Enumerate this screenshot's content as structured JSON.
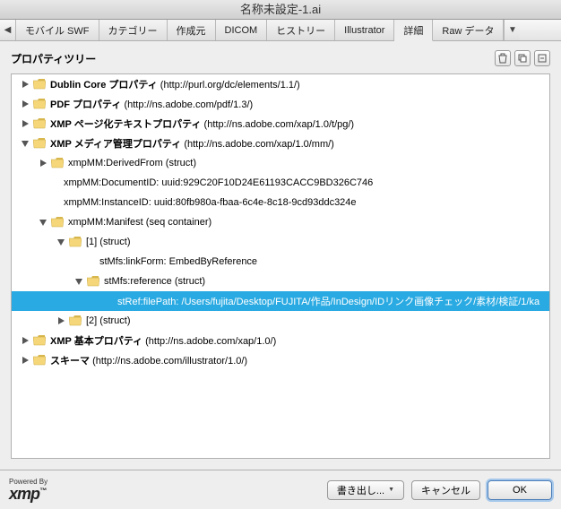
{
  "title": "名称未設定-1.ai",
  "tabs": [
    {
      "label": "モバイル SWF"
    },
    {
      "label": "カテゴリー"
    },
    {
      "label": "作成元"
    },
    {
      "label": "DICOM"
    },
    {
      "label": "ヒストリー"
    },
    {
      "label": "Illustrator"
    },
    {
      "label": "詳細"
    },
    {
      "label": "Raw データ"
    }
  ],
  "active_tab_index": 6,
  "section_title": "プロパティツリー",
  "tree": [
    {
      "indent": 0,
      "open": false,
      "folder": true,
      "bold": "Dublin Core プロパティ",
      "paren": "(http://purl.org/dc/elements/1.1/)"
    },
    {
      "indent": 0,
      "open": false,
      "folder": true,
      "bold": "PDF プロパティ",
      "paren": "(http://ns.adobe.com/pdf/1.3/)"
    },
    {
      "indent": 0,
      "open": false,
      "folder": true,
      "bold": "XMP ページ化テキストプロパティ",
      "paren": "(http://ns.adobe.com/xap/1.0/t/pg/)"
    },
    {
      "indent": 0,
      "open": true,
      "folder": true,
      "bold": "XMP メディア管理プロパティ",
      "paren": "(http://ns.adobe.com/xap/1.0/mm/)"
    },
    {
      "indent": 1,
      "open": false,
      "folder": true,
      "text": "xmpMM:DerivedFrom (struct)"
    },
    {
      "indent": 1,
      "nodis": true,
      "text": "xmpMM:DocumentID: uuid:929C20F10D24E61193CACC9BD326C746"
    },
    {
      "indent": 1,
      "nodis": true,
      "text": "xmpMM:InstanceID: uuid:80fb980a-fbaa-6c4e-8c18-9cd93ddc324e"
    },
    {
      "indent": 1,
      "open": true,
      "folder": true,
      "text": "xmpMM:Manifest (seq container)"
    },
    {
      "indent": 2,
      "open": true,
      "folder": true,
      "text": "[1] (struct)"
    },
    {
      "indent": 3,
      "nodis": true,
      "text": "stMfs:linkForm: EmbedByReference"
    },
    {
      "indent": 3,
      "open": true,
      "folder": true,
      "text": "stMfs:reference (struct)"
    },
    {
      "indent": 4,
      "nodis": true,
      "selected": true,
      "text": "stRef:filePath: /Users/fujita/Desktop/FUJITA/作品/InDesign/IDリンク画像チェック/素材/検証/1/ka"
    },
    {
      "indent": 2,
      "open": false,
      "folder": true,
      "text": "[2] (struct)"
    },
    {
      "indent": 0,
      "open": false,
      "folder": true,
      "bold": "XMP 基本プロパティ",
      "paren": "(http://ns.adobe.com/xap/1.0/)"
    },
    {
      "indent": 0,
      "open": false,
      "folder": true,
      "bold": "スキーマ",
      "paren": "(http://ns.adobe.com/illustrator/1.0/)"
    }
  ],
  "footer": {
    "powered_by": "Powered By",
    "xmp": "xmp",
    "export": "書き出し...",
    "cancel": "キャンセル",
    "ok": "OK"
  },
  "icons": {
    "trash": "trash-icon",
    "expand": "expand-all-icon",
    "collapse": "collapse-all-icon"
  }
}
